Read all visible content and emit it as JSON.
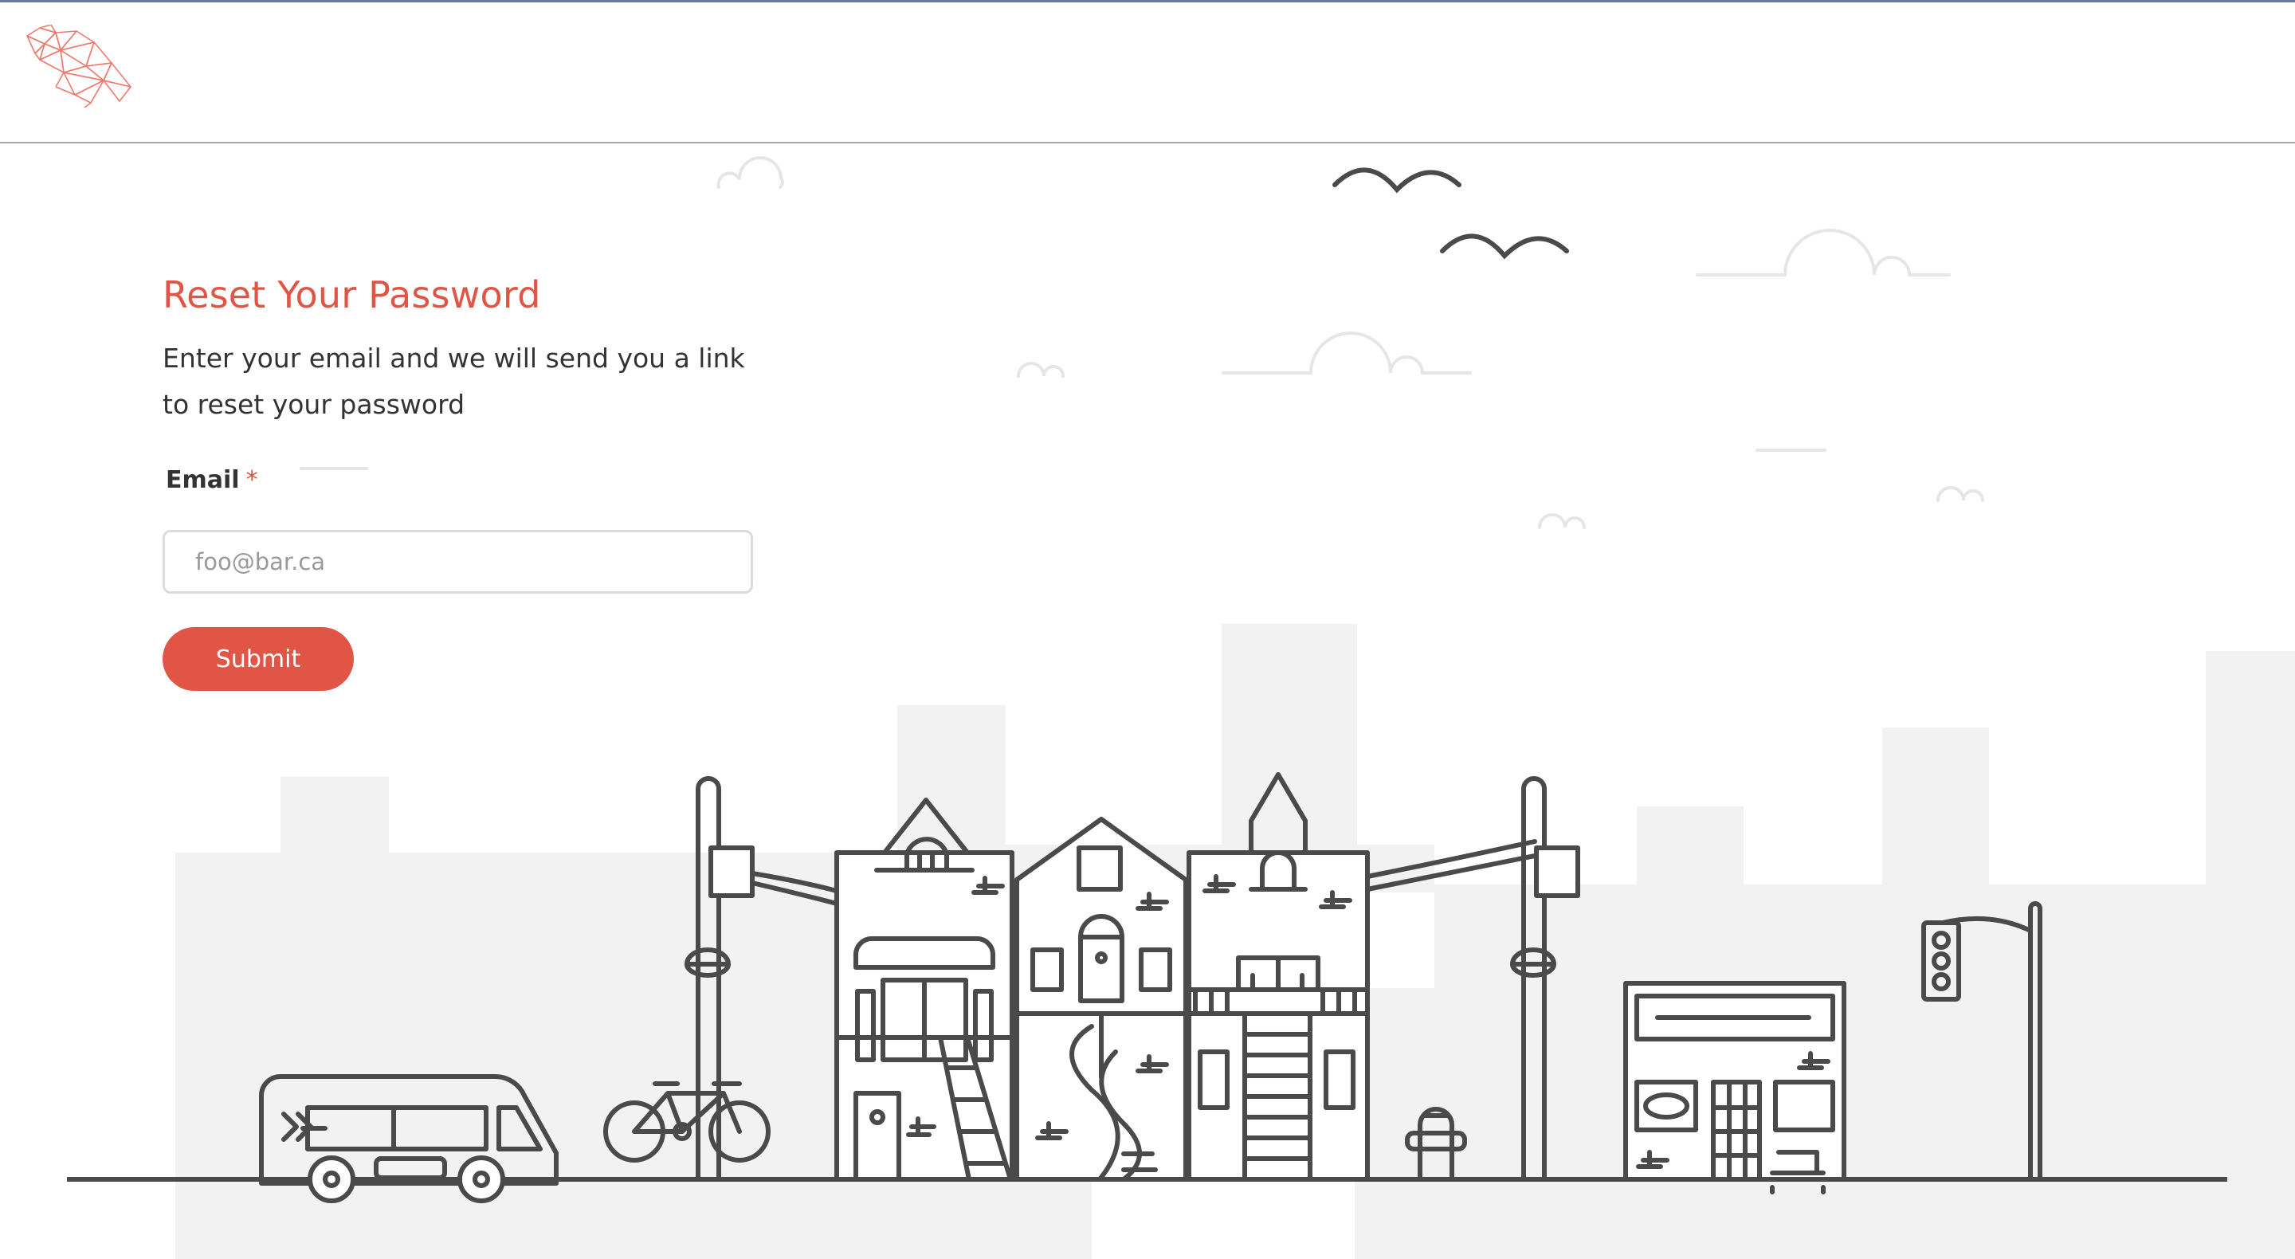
{
  "header": {
    "logo_icon": "geometric-bird-logo-icon",
    "accent": "#e05545"
  },
  "reset_form": {
    "title": "Reset Your Password",
    "subtitle": "Enter your email and we will send you a link to reset your password",
    "email_label": "Email",
    "required_mark": "*",
    "email_placeholder": "foo@bar.ca",
    "email_value": "",
    "submit_label": "Submit"
  },
  "illustration": {
    "description_icon": "city-street-illustration",
    "elements": [
      "bus-icon",
      "bicycle-icon",
      "street-lamp-icon",
      "house-icon",
      "fire-hydrant-icon",
      "storefront-icon",
      "traffic-light-icon",
      "bird-icon",
      "cloud-icon"
    ]
  }
}
